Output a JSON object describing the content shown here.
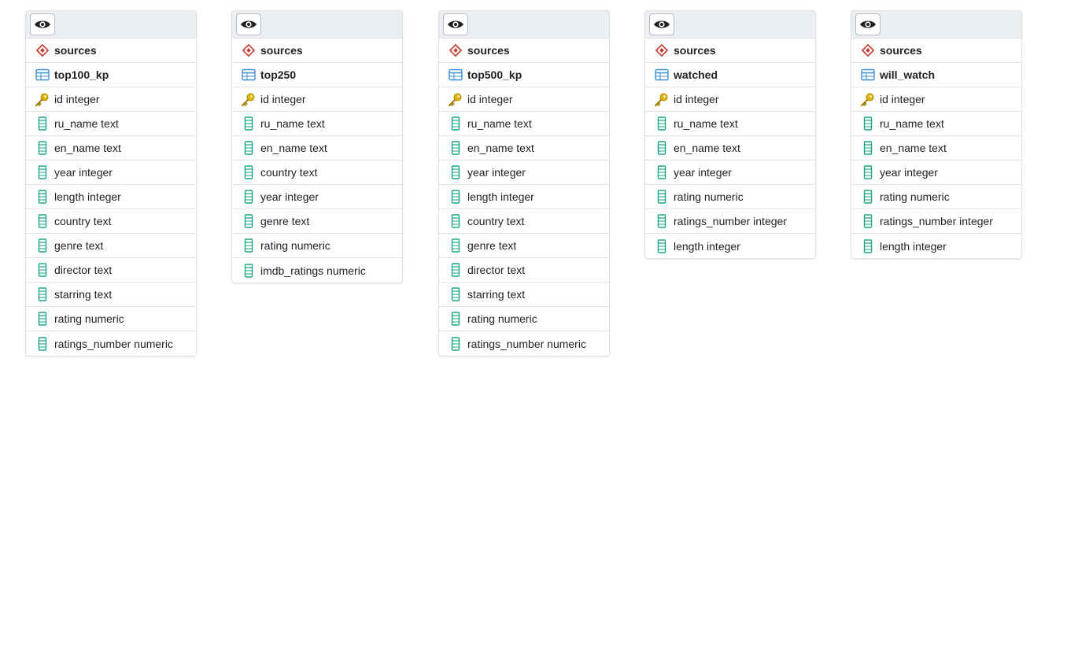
{
  "tables": [
    {
      "schema": "sources",
      "name": "top100_kp",
      "columns": [
        {
          "label": "id integer",
          "key": true
        },
        {
          "label": "ru_name text"
        },
        {
          "label": "en_name text"
        },
        {
          "label": "year integer"
        },
        {
          "label": "length integer"
        },
        {
          "label": "country text"
        },
        {
          "label": "genre text"
        },
        {
          "label": "director text"
        },
        {
          "label": "starring text"
        },
        {
          "label": "rating numeric"
        },
        {
          "label": "ratings_number numeric"
        }
      ]
    },
    {
      "schema": "sources",
      "name": "top250",
      "columns": [
        {
          "label": "id integer",
          "key": true
        },
        {
          "label": "ru_name text"
        },
        {
          "label": "en_name text"
        },
        {
          "label": "country text"
        },
        {
          "label": "year integer"
        },
        {
          "label": "genre text"
        },
        {
          "label": "rating numeric"
        },
        {
          "label": "imdb_ratings numeric"
        }
      ]
    },
    {
      "schema": "sources",
      "name": "top500_kp",
      "columns": [
        {
          "label": "id integer",
          "key": true
        },
        {
          "label": "ru_name text"
        },
        {
          "label": "en_name text"
        },
        {
          "label": "year integer"
        },
        {
          "label": "length integer"
        },
        {
          "label": "country text"
        },
        {
          "label": "genre text"
        },
        {
          "label": "director text"
        },
        {
          "label": "starring text"
        },
        {
          "label": "rating numeric"
        },
        {
          "label": "ratings_number numeric"
        }
      ]
    },
    {
      "schema": "sources",
      "name": "watched",
      "columns": [
        {
          "label": "id integer",
          "key": true
        },
        {
          "label": "ru_name text"
        },
        {
          "label": "en_name text"
        },
        {
          "label": "year integer"
        },
        {
          "label": "rating numeric"
        },
        {
          "label": "ratings_number integer"
        },
        {
          "label": "length integer"
        }
      ]
    },
    {
      "schema": "sources",
      "name": "will_watch",
      "columns": [
        {
          "label": "id integer",
          "key": true
        },
        {
          "label": "ru_name text"
        },
        {
          "label": "en_name text"
        },
        {
          "label": "year integer"
        },
        {
          "label": "rating numeric"
        },
        {
          "label": "ratings_number integer"
        },
        {
          "label": "length integer"
        }
      ]
    }
  ],
  "icons": {
    "header": "eye-icon",
    "schema": "schema-icon",
    "table": "table-icon",
    "key": "primary-key-icon",
    "column": "column-icon"
  },
  "colors": {
    "schema": "#c0392b",
    "table": "#3b8ed0",
    "key": "#e0b400",
    "column": "#1aa587"
  }
}
